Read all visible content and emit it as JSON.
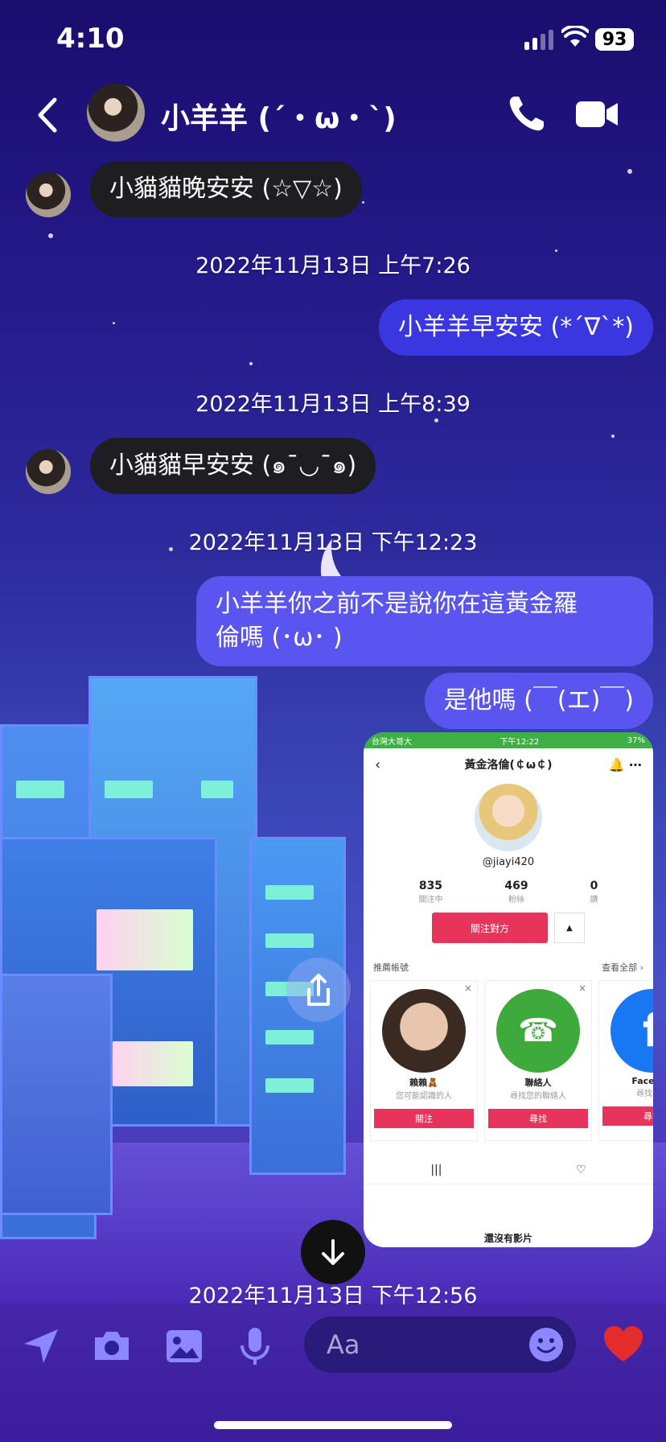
{
  "status": {
    "time": "4:10",
    "battery": "93"
  },
  "header": {
    "name": "小羊羊 (´・ω・`)"
  },
  "messages": {
    "m1": "小貓貓晚安安 (☆▽☆)",
    "t1": "2022年11月13日 上午7:26",
    "m2": "小羊羊早安安 (*´∇`*)",
    "t2": "2022年11月13日 上午8:39",
    "m3": "小貓貓早安安 (๑¯◡¯๑)",
    "t3": "2022年11月13日 下午12:23",
    "m4_line1": "小羊羊你之前不是說你在這黃金羅",
    "m4_line2": "倫嗎 (･ω･ )",
    "m5": "是他嗎 (￣(エ)￣)",
    "t4": "2022年11月13日 下午12:56"
  },
  "screenshot": {
    "carrier": "台灣大哥大",
    "time": "下午12:22",
    "battery": "37%",
    "title": "黃金洛倫(￠ω￠)",
    "handle": "@jiayi420",
    "stats": [
      {
        "value": "835",
        "label": "關注中"
      },
      {
        "value": "469",
        "label": "粉絲"
      },
      {
        "value": "0",
        "label": "讚"
      }
    ],
    "follow_label": "關注對方",
    "rec_label": "推薦帳號",
    "see_all": "查看全部 ›",
    "cards": [
      {
        "name": "賴賴🧸",
        "desc": "您可能認識的人",
        "button": "關注"
      },
      {
        "name": "聯絡人",
        "desc": "尋找您的聯絡人",
        "button": "尋找"
      },
      {
        "name": "Faceboo",
        "desc": "尋找您的",
        "button": "尋找"
      }
    ],
    "no_videos": "還沒有影片"
  },
  "composer": {
    "placeholder": "Aa"
  },
  "colors": {
    "outgoing": "#3a36e0",
    "incoming": "#1e1e22",
    "accent": "#e8345a"
  }
}
